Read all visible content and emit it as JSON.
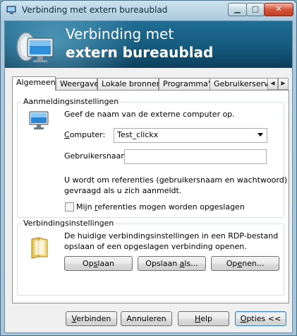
{
  "window": {
    "title": "Verbinding met extern bureaublad"
  },
  "banner": {
    "line1": "Verbinding met",
    "line2": "extern bureaublad"
  },
  "tabs": [
    {
      "label": "Algemeen"
    },
    {
      "label": "Weergave"
    },
    {
      "label": "Lokale bronnen"
    },
    {
      "label": "Programma's"
    },
    {
      "label": "Gebruikerserva"
    }
  ],
  "logon": {
    "title": "Aanmeldingsinstellingen",
    "instruction": "Geef de naam van de externe computer op.",
    "computer_label_pre": "",
    "computer_label_u": "C",
    "computer_label_post": "omputer:",
    "computer_value": "Test_clickx",
    "username_label": "Gebruikersnaam:",
    "username_value": "",
    "info_line1": "U wordt om referenties (gebruikersnaam en wachtwoord)",
    "info_line2": "gevraagd als u zich aanmeldt.",
    "save_creds_pre": "Mijn ",
    "save_creds_u": "r",
    "save_creds_post": "eferenties mogen worden opgeslagen"
  },
  "connection": {
    "title": "Verbindingsinstellingen",
    "text_line1": "De huidige verbindingsinstellingen in een RDP-bestand",
    "text_line2": "opslaan of een opgeslagen verbinding openen.",
    "save_pre": "Op",
    "save_u": "s",
    "save_post": "laan",
    "saveas_pre": "Opslaan ",
    "saveas_u": "a",
    "saveas_post": "ls...",
    "open_pre": "Op",
    "open_u": "e",
    "open_post": "nen..."
  },
  "footer": {
    "connect_u": "V",
    "connect_post": "erbinden",
    "cancel": "Annuleren",
    "help_u": "H",
    "help_post": "elp",
    "options_u": "O",
    "options_post": "pties <<"
  },
  "icons": {
    "app": "remote-desktop-icon",
    "banner": "remote-desktop-monitor-icon",
    "logon": "computer-monitor-icon",
    "connection": "folder-icon"
  }
}
